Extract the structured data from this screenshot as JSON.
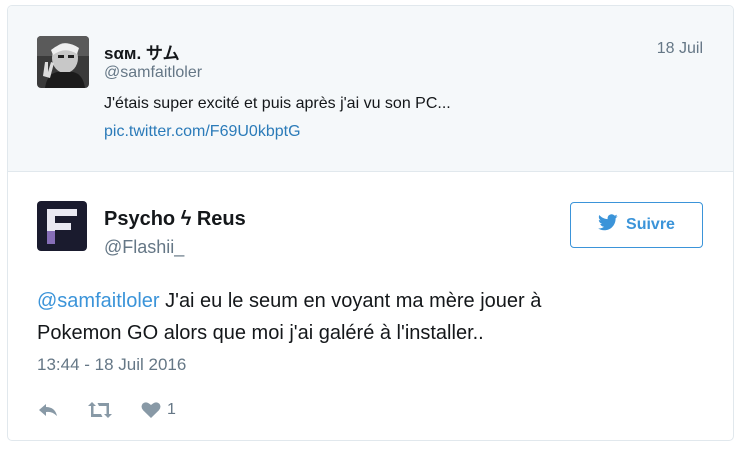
{
  "quoted_tweet": {
    "display_name": "sαм. サム",
    "handle": "@samfaitloler",
    "date": "18 Juil",
    "text": "J'étais super excité et puis après j'ai vu son PC...",
    "link": "pic.twitter.com/F69U0kbptG"
  },
  "tweet": {
    "display_name": "Psycho ϟ Reus",
    "handle": "@Flashii_",
    "follow_label": "Suivre",
    "mention": "@samfaitloler",
    "text_line1": " J'ai eu le seum en voyant ma mère jouer à",
    "text_line2": "Pokemon GO alors que moi j'ai galéré à l'installer..",
    "timestamp": "13:44 - 18 Juil 2016",
    "like_count": "1"
  },
  "icons": {
    "reply": "reply-icon",
    "retweet": "retweet-icon",
    "like": "heart-icon",
    "follow": "twitter-bird-icon"
  },
  "colors": {
    "link": "#3b94d9",
    "muted": "#657786",
    "quoted_bg": "#f5f8fa"
  }
}
